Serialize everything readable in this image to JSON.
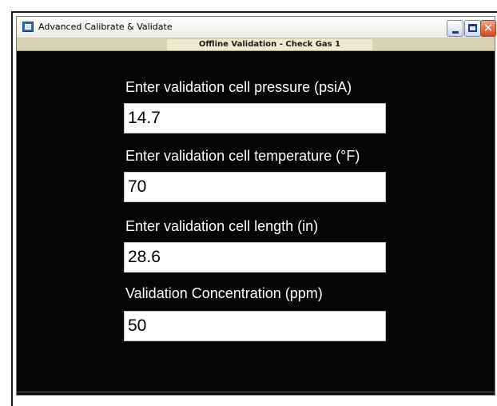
{
  "window": {
    "title": "Advanced Calibrate & Validate",
    "subheader": "Offline Validation - Check Gas 1",
    "buttons": {
      "minimize": "_",
      "maximize": "□",
      "close": "✕"
    }
  },
  "fields": [
    {
      "label": "Enter validation cell pressure (psiA)",
      "value": "14.7"
    },
    {
      "label": "Enter validation cell temperature (°F)",
      "value": "70"
    },
    {
      "label": "Enter validation cell length (in)",
      "value": "28.6"
    },
    {
      "label": "Validation Concentration (ppm)",
      "value": "50"
    }
  ]
}
